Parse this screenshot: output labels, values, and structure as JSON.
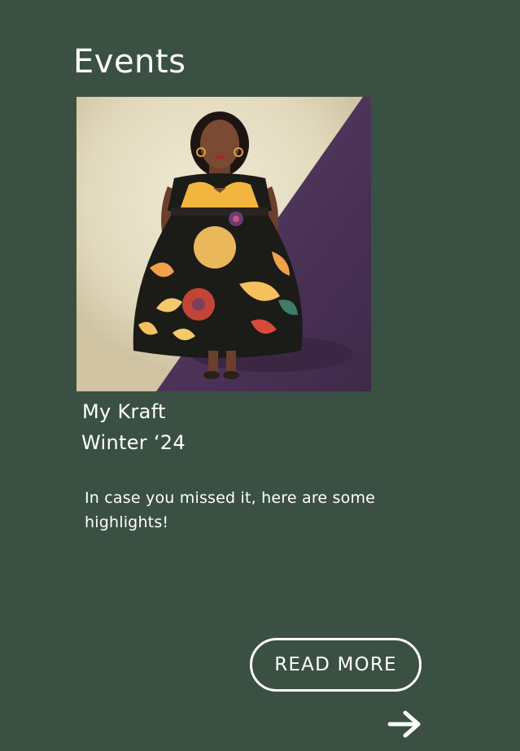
{
  "section": {
    "title": "Events"
  },
  "event": {
    "title_line1": "My Kraft",
    "title_line2": "Winter ‘24",
    "description": "In case you missed it, here are some highlights!",
    "read_more_label": "READ MORE",
    "image_icon": "event-illustration",
    "arrow_icon": "arrow-right-icon"
  },
  "colors": {
    "background": "#3a5043",
    "text": "#ffffff",
    "image_light": "#e0d8c0",
    "image_purple": "#4c3258"
  }
}
